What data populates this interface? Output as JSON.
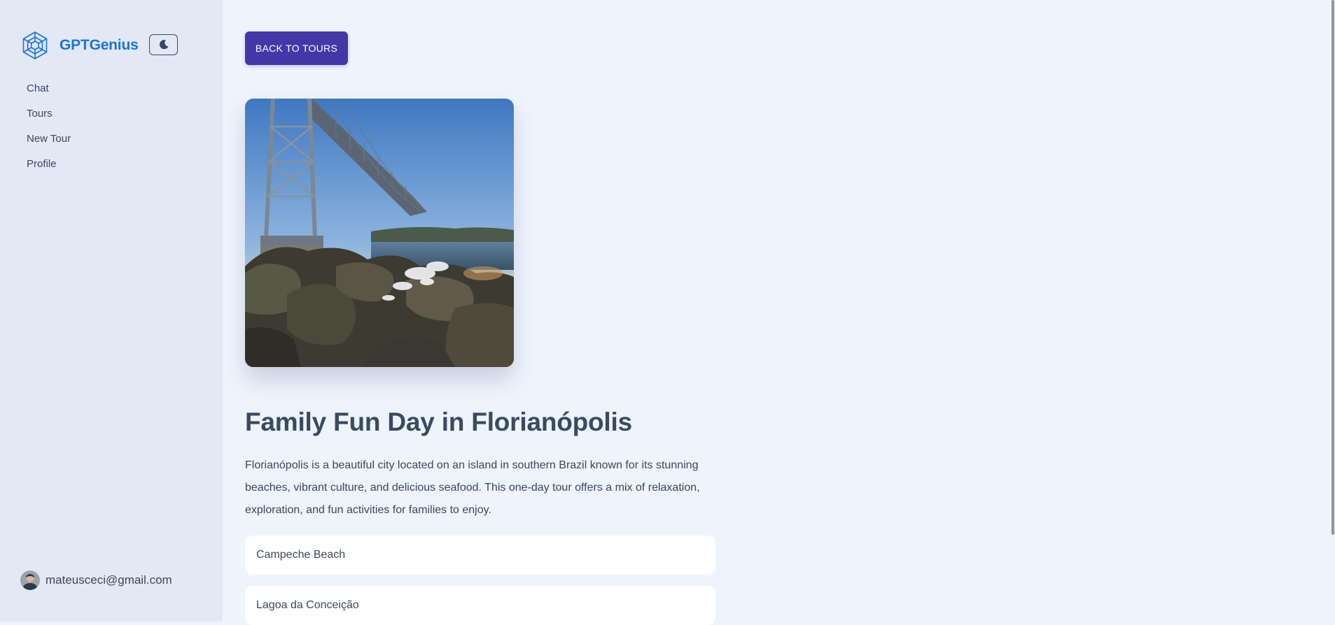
{
  "brand": {
    "name": "GPTGenius",
    "logo_icon": "hexagon-cube-logo-icon"
  },
  "theme_toggle": {
    "icon": "moon-icon"
  },
  "nav": {
    "items": [
      {
        "label": "Chat"
      },
      {
        "label": "Tours"
      },
      {
        "label": "New Tour"
      },
      {
        "label": "Profile"
      }
    ]
  },
  "user": {
    "email": "mateusceci@gmail.com"
  },
  "main": {
    "back_button": "BACK TO TOURS",
    "title": "Family Fun Day in Florianópolis",
    "description": "Florianópolis is a beautiful city located on an island in southern Brazil known for its stunning beaches, vibrant culture, and delicious seafood. This one-day tour offers a mix of relaxation, exploration, and fun activities for families to enjoy.",
    "stops": [
      {
        "name": "Campeche Beach"
      },
      {
        "name": "Lagoa da Conceição"
      }
    ]
  },
  "colors": {
    "brand": "#1a72e8",
    "button": "#4338a8",
    "sidebar_bg": "#e2e9f5",
    "main_bg": "#eef4fd"
  }
}
